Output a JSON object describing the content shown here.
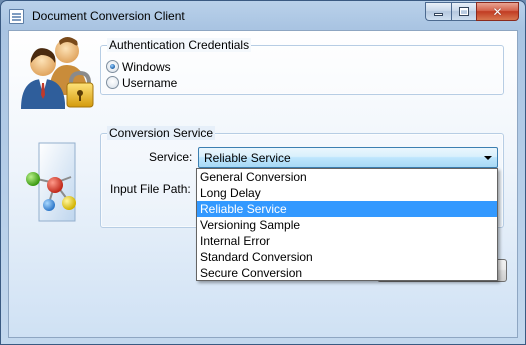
{
  "window": {
    "title": "Document Conversion Client",
    "controls": {
      "minimize": "minimize-icon",
      "maximize": "maximize-icon",
      "close": "close-icon"
    }
  },
  "auth": {
    "group_label": "Authentication Credentials",
    "options": [
      "Windows",
      "Username"
    ],
    "selected": "Windows"
  },
  "conversion": {
    "group_label": "Conversion Service",
    "service_label": "Service:",
    "service_value": "Reliable Service",
    "path_label": "Input File Path:",
    "path_value": "",
    "service_options": [
      "General Conversion",
      "Long Delay",
      "Reliable Service",
      "Versioning Sample",
      "Internal Error",
      "Standard Conversion",
      "Secure Conversion"
    ]
  },
  "icons": {
    "users": "users-lock-icon",
    "document": "document-molecule-icon"
  },
  "colors": {
    "selection": "#3399ff",
    "close_button": "#c13b22",
    "combo_border": "#3c7fb1"
  }
}
